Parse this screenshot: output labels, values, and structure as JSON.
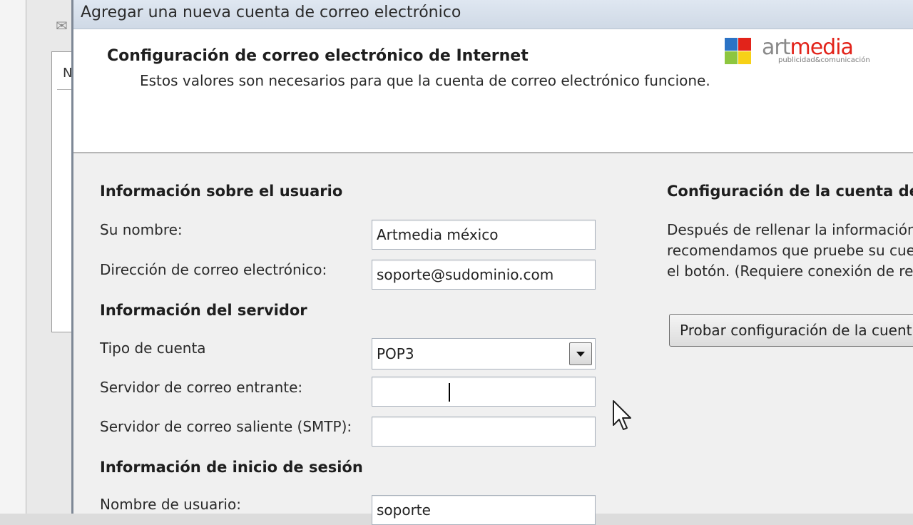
{
  "background": {
    "panel_letter": "N"
  },
  "dialog": {
    "title": "Agregar una nueva cuenta de correo electrónico",
    "header": {
      "title": "Configuración de correo electrónico de Internet",
      "subtitle": "Estos valores son necesarios para que la cuenta de correo electrónico funcione."
    },
    "logo": {
      "word_part1": "art",
      "word_part2": "media",
      "tagline": "publicidad&comunicación",
      "colors": [
        "#2b73c5",
        "#e2231a",
        "#8dc63f",
        "#f7d117"
      ]
    },
    "user_info": {
      "title": "Información sobre el usuario",
      "name_label": "Su nombre:",
      "name_value": "Artmedia méxico",
      "email_label": "Dirección de correo electrónico:",
      "email_value": "soporte@sudominio.com"
    },
    "server_info": {
      "title": "Información del servidor",
      "account_type_label": "Tipo de cuenta",
      "account_type_value": "POP3",
      "incoming_label": "Servidor de correo entrante:",
      "incoming_value": "",
      "outgoing_label": "Servidor de correo saliente (SMTP):",
      "outgoing_value": ""
    },
    "login_info": {
      "title": "Información de inicio de sesión",
      "username_label": "Nombre de usuario:",
      "username_value": "soporte"
    },
    "test_settings": {
      "title": "Configuración de la cuenta de",
      "line1": "Después de rellenar la información",
      "line2": "recomendamos que pruebe su cue",
      "line3": "el botón. (Requiere conexión de re",
      "button_label": "Probar configuración de la cuent"
    }
  }
}
